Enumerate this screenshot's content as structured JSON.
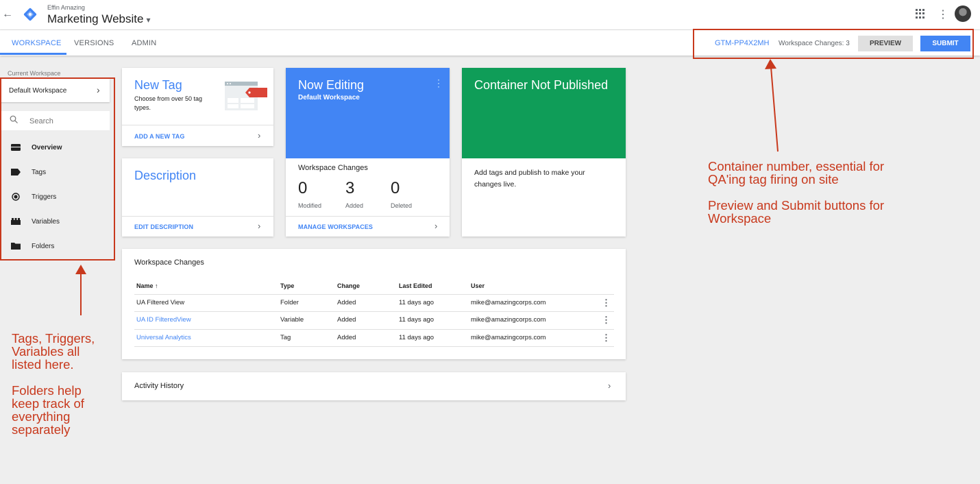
{
  "header": {
    "account_name": "Effin Amazing",
    "container_name": "Marketing Website",
    "caret": "▾",
    "back_icon": "arrow-back-icon"
  },
  "tabs": {
    "workspace": "WORKSPACE",
    "versions": "VERSIONS",
    "admin": "ADMIN"
  },
  "toolbar": {
    "container_id": "GTM-PP4X2MH",
    "workspace_changes": "Workspace Changes: 3",
    "preview_label": "PREVIEW",
    "submit_label": "SUBMIT"
  },
  "sidebar": {
    "current_workspace_label": "Current Workspace",
    "workspace_name": "Default Workspace",
    "search_placeholder": "Search",
    "items": [
      {
        "label": "Overview",
        "icon": "overview-icon"
      },
      {
        "label": "Tags",
        "icon": "tag-icon"
      },
      {
        "label": "Triggers",
        "icon": "trigger-icon"
      },
      {
        "label": "Variables",
        "icon": "variables-icon"
      },
      {
        "label": "Folders",
        "icon": "folder-icon"
      }
    ]
  },
  "new_tag_card": {
    "title": "New Tag",
    "description": "Choose from over 50 tag types.",
    "link": "ADD A NEW TAG"
  },
  "description_card": {
    "title": "Description",
    "link": "EDIT DESCRIPTION"
  },
  "now_editing_card": {
    "title": "Now Editing",
    "subtitle": "Default Workspace",
    "changes_label": "Workspace Changes",
    "modified_count": "0",
    "modified_label": "Modified",
    "added_count": "3",
    "added_label": "Added",
    "deleted_count": "0",
    "deleted_label": "Deleted",
    "link": "MANAGE WORKSPACES"
  },
  "not_published_card": {
    "title": "Container Not Published",
    "body": "Add tags and publish to make your changes live."
  },
  "changes_table": {
    "title": "Workspace Changes",
    "headers": {
      "name": "Name ↑",
      "type": "Type",
      "change": "Change",
      "last_edited": "Last Edited",
      "user": "User"
    },
    "rows": [
      {
        "name": "UA Filtered View",
        "type": "Folder",
        "change": "Added",
        "last_edited": "11 days ago",
        "user": "mike@amazingcorps.com"
      },
      {
        "name": "UA ID FilteredView",
        "type": "Variable",
        "change": "Added",
        "last_edited": "11 days ago",
        "user": "mike@amazingcorps.com"
      },
      {
        "name": "Universal Analytics",
        "type": "Tag",
        "change": "Added",
        "last_edited": "11 days ago",
        "user": "mike@amazingcorps.com"
      }
    ]
  },
  "activity": {
    "title": "Activity History"
  },
  "annotations": {
    "right_line1": "Container number, essential for",
    "right_line2": "QA'ing tag firing on site",
    "right_line3": "Preview and Submit buttons for",
    "right_line4": "Workspace",
    "left_line1": "Tags, Triggers,",
    "left_line2": "Variables all",
    "left_line3": "listed here.",
    "left_line4": "Folders help",
    "left_line5": "keep track of",
    "left_line6": "everything",
    "left_line7": "separately",
    "color": "#c8391d"
  },
  "colors": {
    "accent_blue": "#4285f4",
    "green": "#0f9d58",
    "tag_red": "#db4437"
  }
}
